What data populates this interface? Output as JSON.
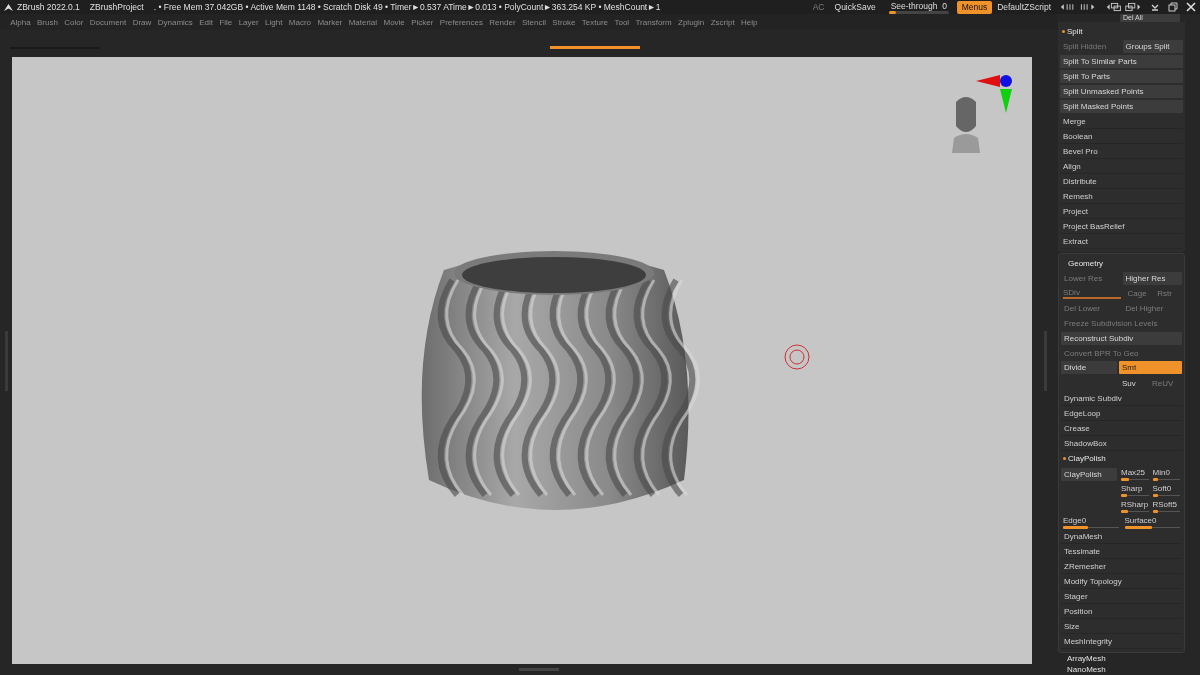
{
  "title_bar": {
    "app": "ZBrush 2022.0.1",
    "project": "ZBrushProject",
    "stats": ". • Free Mem 37.042GB • Active Mem 1148 • Scratch Disk 49 •  Timer►0.537 ATime►0.013 • PolyCount►363.254 KP  • MeshCount►1",
    "ac": {
      "label": "AC",
      "disabled": true
    },
    "quicksave": "QuickSave",
    "see_through": {
      "label": "See-through",
      "value": "0",
      "level": 0.12
    },
    "menus": {
      "label": "Menus",
      "selected": true
    },
    "script": "DefaultZScript"
  },
  "menu_bar": [
    "Alpha",
    "Brush",
    "Color",
    "Document",
    "Draw",
    "Dynamics",
    "Edit",
    "File",
    "Layer",
    "Light",
    "Macro",
    "Marker",
    "Material",
    "Movie",
    "Picker",
    "Preferences",
    "Render",
    "Stencil",
    "Stroke",
    "Texture",
    "Tool",
    "Transform",
    "Zplugin",
    "Zscript",
    "Help"
  ],
  "right_panel": {
    "top_button": "Del All",
    "sections": [
      {
        "kind": "subpalette",
        "title": "Split",
        "rows": [
          {
            "kind": "pair",
            "buttons": [
              {
                "label": "Split Hidden",
                "disabled": true
              },
              {
                "label": "Groups Split",
                "disabled": false
              }
            ]
          },
          {
            "kind": "button",
            "label": "Split To Similar Parts",
            "disabled": false
          },
          {
            "kind": "button",
            "label": "Split To Parts",
            "disabled": false
          },
          {
            "kind": "button",
            "label": "Split Unmasked Points",
            "disabled": false
          },
          {
            "kind": "button",
            "label": "Split Masked Points",
            "disabled": false
          },
          {
            "kind": "item",
            "label": "Merge"
          },
          {
            "kind": "item",
            "label": "Boolean"
          },
          {
            "kind": "item",
            "label": "Bevel Pro"
          },
          {
            "kind": "item",
            "label": "Align"
          },
          {
            "kind": "item",
            "label": "Distribute"
          },
          {
            "kind": "item",
            "label": "Remesh"
          },
          {
            "kind": "item",
            "label": "Project"
          },
          {
            "kind": "item",
            "label": "Project BasRelief"
          },
          {
            "kind": "item",
            "label": "Extract"
          }
        ]
      },
      {
        "kind": "palette",
        "title": "Geometry",
        "rows": [
          {
            "kind": "pair",
            "buttons": [
              {
                "label": "Lower Res",
                "disabled": true
              },
              {
                "label": "Higher Res",
                "disabled": false
              }
            ]
          },
          {
            "kind": "sdiv",
            "slider": {
              "label": "SDiv",
              "level": 1,
              "disabled": true
            },
            "buttons": [
              {
                "label": "Cage",
                "disabled": true
              },
              {
                "label": "Rstr",
                "disabled": true
              }
            ]
          },
          {
            "kind": "pair",
            "buttons": [
              {
                "label": "Del Lower",
                "disabled": true
              },
              {
                "label": "Del Higher",
                "disabled": true
              }
            ]
          },
          {
            "kind": "button",
            "label": "Freeze Subdivision Levels",
            "disabled": true
          },
          {
            "kind": "button",
            "label": "Reconstruct Subdiv",
            "disabled": false
          },
          {
            "kind": "button",
            "label": "Convert BPR To Geo",
            "disabled": true
          },
          {
            "kind": "divide",
            "label": "Divide",
            "options": [
              {
                "label": "Smt",
                "selected": true,
                "disabled": false
              },
              {
                "label": "Suv",
                "selected": false,
                "disabled": false
              },
              {
                "label": "ReUV",
                "selected": false,
                "disabled": true
              }
            ]
          },
          {
            "kind": "item",
            "label": "Dynamic Subdiv"
          },
          {
            "kind": "item",
            "label": "EdgeLoop"
          },
          {
            "kind": "item",
            "label": "Crease"
          },
          {
            "kind": "item",
            "label": "ShadowBox"
          },
          {
            "kind": "subheader",
            "label": "ClayPolish"
          },
          {
            "kind": "claypolish",
            "label": "ClayPolish",
            "sliders": [
              {
                "label": "Max",
                "value": "25",
                "level": 0.3
              },
              {
                "label": "Min",
                "value": "0",
                "level": 0.2
              },
              {
                "label": "Sharp",
                "level": 0.2
              },
              {
                "label": "Soft",
                "value": "0",
                "level": 0.2
              },
              {
                "label": "RSharp",
                "level": 0.25
              },
              {
                "label": "RSoft",
                "value": "5",
                "level": 0.2
              }
            ]
          },
          {
            "kind": "sliders",
            "sliders": [
              {
                "label": "Edge",
                "value": "0",
                "level": 0.45
              },
              {
                "label": "Surface",
                "value": "0",
                "level": 0.5
              }
            ]
          },
          {
            "kind": "item",
            "label": "DynaMesh"
          },
          {
            "kind": "item",
            "label": "Tessimate"
          },
          {
            "kind": "item",
            "label": "ZRemesher"
          },
          {
            "kind": "item",
            "label": "Modify Topology"
          },
          {
            "kind": "item",
            "label": "Stager"
          },
          {
            "kind": "item",
            "label": "Position"
          },
          {
            "kind": "item",
            "label": "Size"
          },
          {
            "kind": "item",
            "label": "MeshIntegrity"
          }
        ]
      }
    ],
    "below": [
      "ArrayMesh",
      "NanoMesh"
    ]
  }
}
